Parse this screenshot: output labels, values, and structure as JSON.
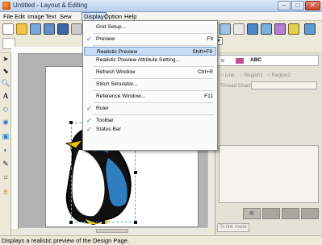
{
  "window": {
    "title": "Untitled - Layout & Editing"
  },
  "menubar": {
    "items": [
      "File",
      "Edit",
      "Image",
      "Text",
      "Sew",
      "Display",
      "Option",
      "Help"
    ]
  },
  "display_menu": {
    "items": [
      {
        "label": "Grid Setup...",
        "shortcut": "",
        "checked": false
      },
      {
        "label": "Preview",
        "shortcut": "F9",
        "checked": true
      },
      {
        "label": "Realistic Preview",
        "shortcut": "Shift+F9",
        "checked": false,
        "highlighted": true
      },
      {
        "label": "Realistic Preview Attribute Setting...",
        "shortcut": "",
        "checked": false
      },
      {
        "label": "Refresh Window",
        "shortcut": "Ctrl+R",
        "checked": false
      },
      {
        "label": "Stitch Simulator...",
        "shortcut": "",
        "checked": false
      },
      {
        "label": "Reference Window...",
        "shortcut": "F11",
        "checked": false
      },
      {
        "label": "Ruler",
        "shortcut": "",
        "checked": true
      },
      {
        "label": "Toolbar",
        "shortcut": "",
        "checked": true
      },
      {
        "label": "Status Bar",
        "shortcut": "",
        "checked": true
      }
    ],
    "check_glyph": "✓"
  },
  "right_panel": {
    "tab_label": "ABC",
    "radio_line": "Line",
    "radio_region1": "Region1",
    "radio_region2": "Region2",
    "thread_chart_label": "Thread Chart",
    "to_hoop_button": "To link mode"
  },
  "statusbar": {
    "text": "Displays a realistic preview of the Design Page."
  },
  "colors": {
    "penguin_blue": "#2f7fc0",
    "menu_highlight": "#c7dcf5"
  }
}
